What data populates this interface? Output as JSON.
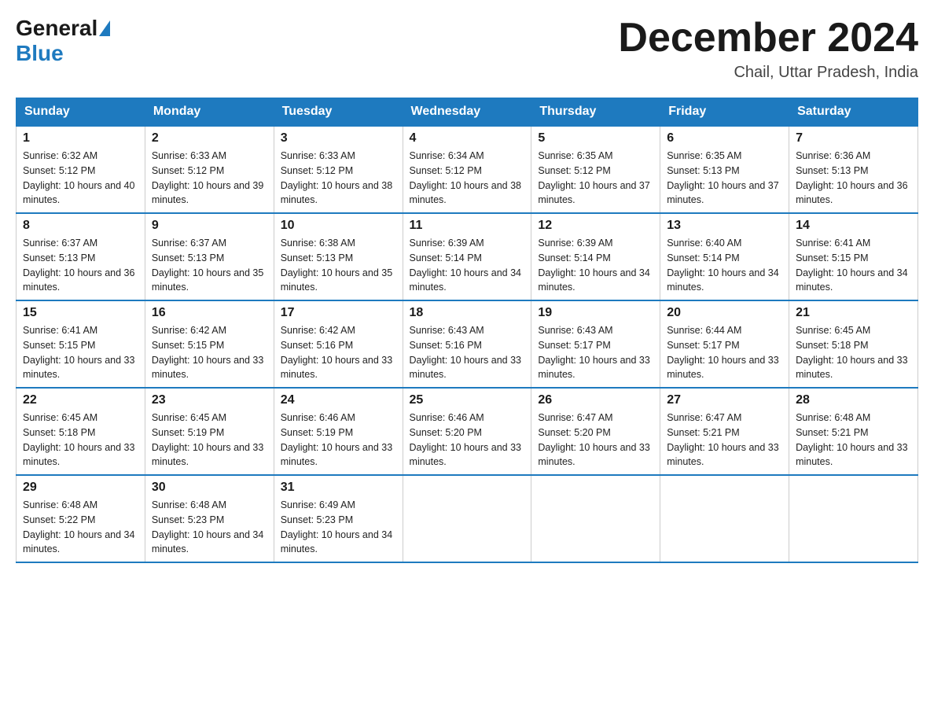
{
  "logo": {
    "general": "General",
    "blue": "Blue"
  },
  "title": "December 2024",
  "location": "Chail, Uttar Pradesh, India",
  "days_header": [
    "Sunday",
    "Monday",
    "Tuesday",
    "Wednesday",
    "Thursday",
    "Friday",
    "Saturday"
  ],
  "weeks": [
    [
      {
        "day": "1",
        "sunrise": "6:32 AM",
        "sunset": "5:12 PM",
        "daylight": "10 hours and 40 minutes."
      },
      {
        "day": "2",
        "sunrise": "6:33 AM",
        "sunset": "5:12 PM",
        "daylight": "10 hours and 39 minutes."
      },
      {
        "day": "3",
        "sunrise": "6:33 AM",
        "sunset": "5:12 PM",
        "daylight": "10 hours and 38 minutes."
      },
      {
        "day": "4",
        "sunrise": "6:34 AM",
        "sunset": "5:12 PM",
        "daylight": "10 hours and 38 minutes."
      },
      {
        "day": "5",
        "sunrise": "6:35 AM",
        "sunset": "5:12 PM",
        "daylight": "10 hours and 37 minutes."
      },
      {
        "day": "6",
        "sunrise": "6:35 AM",
        "sunset": "5:13 PM",
        "daylight": "10 hours and 37 minutes."
      },
      {
        "day": "7",
        "sunrise": "6:36 AM",
        "sunset": "5:13 PM",
        "daylight": "10 hours and 36 minutes."
      }
    ],
    [
      {
        "day": "8",
        "sunrise": "6:37 AM",
        "sunset": "5:13 PM",
        "daylight": "10 hours and 36 minutes."
      },
      {
        "day": "9",
        "sunrise": "6:37 AM",
        "sunset": "5:13 PM",
        "daylight": "10 hours and 35 minutes."
      },
      {
        "day": "10",
        "sunrise": "6:38 AM",
        "sunset": "5:13 PM",
        "daylight": "10 hours and 35 minutes."
      },
      {
        "day": "11",
        "sunrise": "6:39 AM",
        "sunset": "5:14 PM",
        "daylight": "10 hours and 34 minutes."
      },
      {
        "day": "12",
        "sunrise": "6:39 AM",
        "sunset": "5:14 PM",
        "daylight": "10 hours and 34 minutes."
      },
      {
        "day": "13",
        "sunrise": "6:40 AM",
        "sunset": "5:14 PM",
        "daylight": "10 hours and 34 minutes."
      },
      {
        "day": "14",
        "sunrise": "6:41 AM",
        "sunset": "5:15 PM",
        "daylight": "10 hours and 34 minutes."
      }
    ],
    [
      {
        "day": "15",
        "sunrise": "6:41 AM",
        "sunset": "5:15 PM",
        "daylight": "10 hours and 33 minutes."
      },
      {
        "day": "16",
        "sunrise": "6:42 AM",
        "sunset": "5:15 PM",
        "daylight": "10 hours and 33 minutes."
      },
      {
        "day": "17",
        "sunrise": "6:42 AM",
        "sunset": "5:16 PM",
        "daylight": "10 hours and 33 minutes."
      },
      {
        "day": "18",
        "sunrise": "6:43 AM",
        "sunset": "5:16 PM",
        "daylight": "10 hours and 33 minutes."
      },
      {
        "day": "19",
        "sunrise": "6:43 AM",
        "sunset": "5:17 PM",
        "daylight": "10 hours and 33 minutes."
      },
      {
        "day": "20",
        "sunrise": "6:44 AM",
        "sunset": "5:17 PM",
        "daylight": "10 hours and 33 minutes."
      },
      {
        "day": "21",
        "sunrise": "6:45 AM",
        "sunset": "5:18 PM",
        "daylight": "10 hours and 33 minutes."
      }
    ],
    [
      {
        "day": "22",
        "sunrise": "6:45 AM",
        "sunset": "5:18 PM",
        "daylight": "10 hours and 33 minutes."
      },
      {
        "day": "23",
        "sunrise": "6:45 AM",
        "sunset": "5:19 PM",
        "daylight": "10 hours and 33 minutes."
      },
      {
        "day": "24",
        "sunrise": "6:46 AM",
        "sunset": "5:19 PM",
        "daylight": "10 hours and 33 minutes."
      },
      {
        "day": "25",
        "sunrise": "6:46 AM",
        "sunset": "5:20 PM",
        "daylight": "10 hours and 33 minutes."
      },
      {
        "day": "26",
        "sunrise": "6:47 AM",
        "sunset": "5:20 PM",
        "daylight": "10 hours and 33 minutes."
      },
      {
        "day": "27",
        "sunrise": "6:47 AM",
        "sunset": "5:21 PM",
        "daylight": "10 hours and 33 minutes."
      },
      {
        "day": "28",
        "sunrise": "6:48 AM",
        "sunset": "5:21 PM",
        "daylight": "10 hours and 33 minutes."
      }
    ],
    [
      {
        "day": "29",
        "sunrise": "6:48 AM",
        "sunset": "5:22 PM",
        "daylight": "10 hours and 34 minutes."
      },
      {
        "day": "30",
        "sunrise": "6:48 AM",
        "sunset": "5:23 PM",
        "daylight": "10 hours and 34 minutes."
      },
      {
        "day": "31",
        "sunrise": "6:49 AM",
        "sunset": "5:23 PM",
        "daylight": "10 hours and 34 minutes."
      },
      null,
      null,
      null,
      null
    ]
  ]
}
